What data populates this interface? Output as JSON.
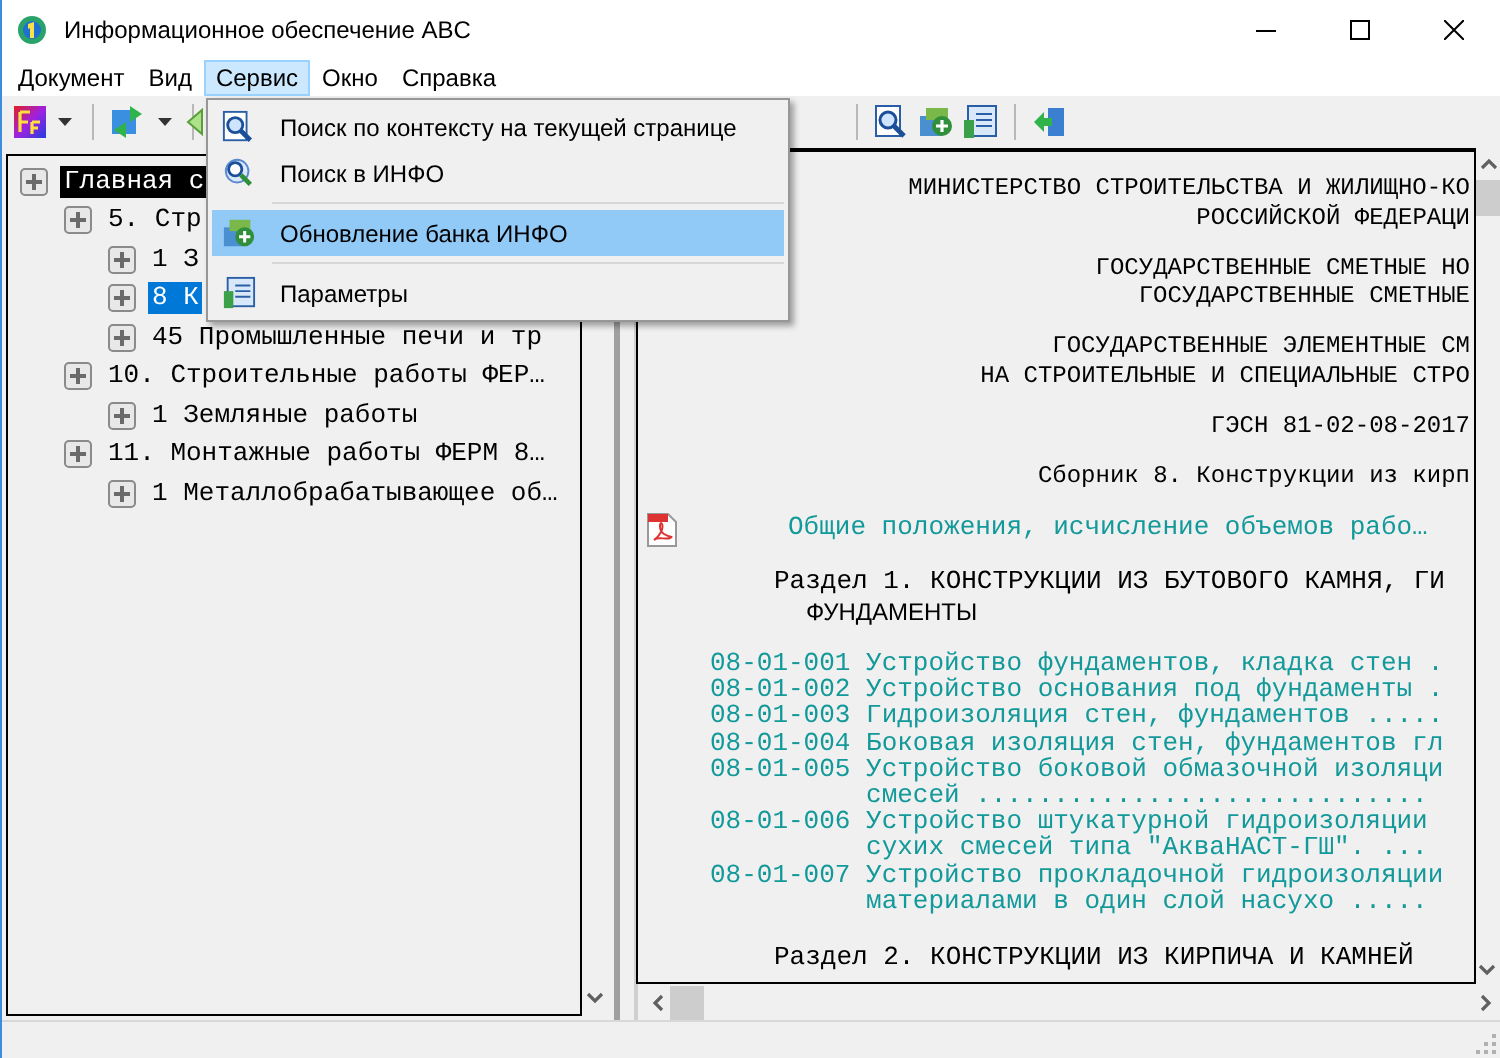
{
  "window": {
    "title": "Информационное обеспечение ABC"
  },
  "menubar": [
    {
      "label": "Документ",
      "selected": false
    },
    {
      "label": "Вид",
      "selected": false
    },
    {
      "label": "Сервис",
      "selected": true
    },
    {
      "label": "Окно",
      "selected": false
    },
    {
      "label": "Справка",
      "selected": false
    }
  ],
  "dropdown": [
    {
      "kind": "item",
      "label": "Поиск по контексту на текущей странице",
      "selected": false
    },
    {
      "kind": "item",
      "label": "Поиск в ИНФО",
      "selected": false
    },
    {
      "kind": "separator"
    },
    {
      "kind": "item",
      "label": "Обновление банка ИНФО",
      "selected": true
    },
    {
      "kind": "separator"
    },
    {
      "kind": "item",
      "label": "Параметры",
      "selected": false
    }
  ],
  "tree": [
    {
      "label": "Главная с",
      "current": true,
      "selected": false,
      "children": [
        {
          "label": "5. Стр",
          "current": false,
          "selected": false,
          "children": [
            {
              "label": "1 З",
              "current": false,
              "selected": false
            },
            {
              "label": "8 К",
              "current": false,
              "selected": true
            },
            {
              "label": "45 Промышленные печи и тр",
              "current": false,
              "selected": false
            }
          ]
        },
        {
          "label": "10. Строительные работы ФЕР…",
          "current": false,
          "selected": false,
          "children": [
            {
              "label": "1 Земляные работы",
              "current": false,
              "selected": false
            }
          ]
        },
        {
          "label": "11. Монтажные работы ФЕРМ 8…",
          "current": false,
          "selected": false,
          "children": [
            {
              "label": "1 Металлобрабатывающее об…",
              "current": false,
              "selected": false
            }
          ]
        }
      ]
    }
  ],
  "document": [
    {
      "kind": "title",
      "lines": [
        "МИНИСТЕРСТВО СТРОИТЕЛЬСТВА И ЖИЛИЩНО-КО",
        "РОССИЙСКОЙ ФЕДЕРАЦИ"
      ]
    },
    {
      "kind": "title",
      "lines": [
        "ГОСУДАРСТВЕННЫЕ СМЕТНЫЕ НО",
        "ГОСУДАРСТВЕННЫЕ СМЕТНЫЕ"
      ]
    },
    {
      "kind": "title",
      "lines": [
        "ГОСУДАРСТВЕННЫЕ ЭЛЕМЕНТНЫЕ СМ",
        "НА СТРОИТЕЛЬНЫЕ И СПЕЦИАЛЬНЫЕ СТРО"
      ]
    },
    {
      "kind": "title",
      "lines": [
        "ГЭСН 81-02-08-2017"
      ]
    },
    {
      "kind": "title",
      "lines": [
        "Сборник 8. Конструкции из кирп"
      ]
    },
    {
      "kind": "link",
      "text": "Общие положения, исчисление объемов рабо…"
    },
    {
      "kind": "section",
      "lines": [
        "Раздел 1. КОНСТРУКЦИИ ИЗ БУТОВОГО КАМНЯ, ГИ",
        "ФУНДАМЕНТЫ"
      ]
    },
    {
      "kind": "entry",
      "code": "08-01-001",
      "lines": [
        "Устройство фундаментов, кладка стен ."
      ]
    },
    {
      "kind": "entry",
      "code": "08-01-002",
      "lines": [
        "Устройство основания под фундаменты ."
      ]
    },
    {
      "kind": "entry",
      "code": "08-01-003",
      "lines": [
        "Гидроизоляция стен, фундаментов ....."
      ]
    },
    {
      "kind": "entry",
      "code": "08-01-004",
      "lines": [
        "Боковая изоляция стен, фундаментов гл"
      ]
    },
    {
      "kind": "entry",
      "code": "08-01-005",
      "lines": [
        "Устройство боковой обмазочной изоляци",
        "смесей ............................."
      ]
    },
    {
      "kind": "entry",
      "code": "08-01-006",
      "lines": [
        "Устройство штукатурной гидроизоляции",
        "сухих смесей типа \"АкваНАСТ-ГШ\". ..."
      ]
    },
    {
      "kind": "entry",
      "code": "08-01-007",
      "lines": [
        "Устройство прокладочной гидроизоляции",
        "материалами в один слой насухо ....."
      ]
    },
    {
      "kind": "section",
      "lines": [
        "Раздел 2. КОНСТРУКЦИИ ИЗ КИРПИЧА И КАМНЕЙ"
      ]
    }
  ]
}
